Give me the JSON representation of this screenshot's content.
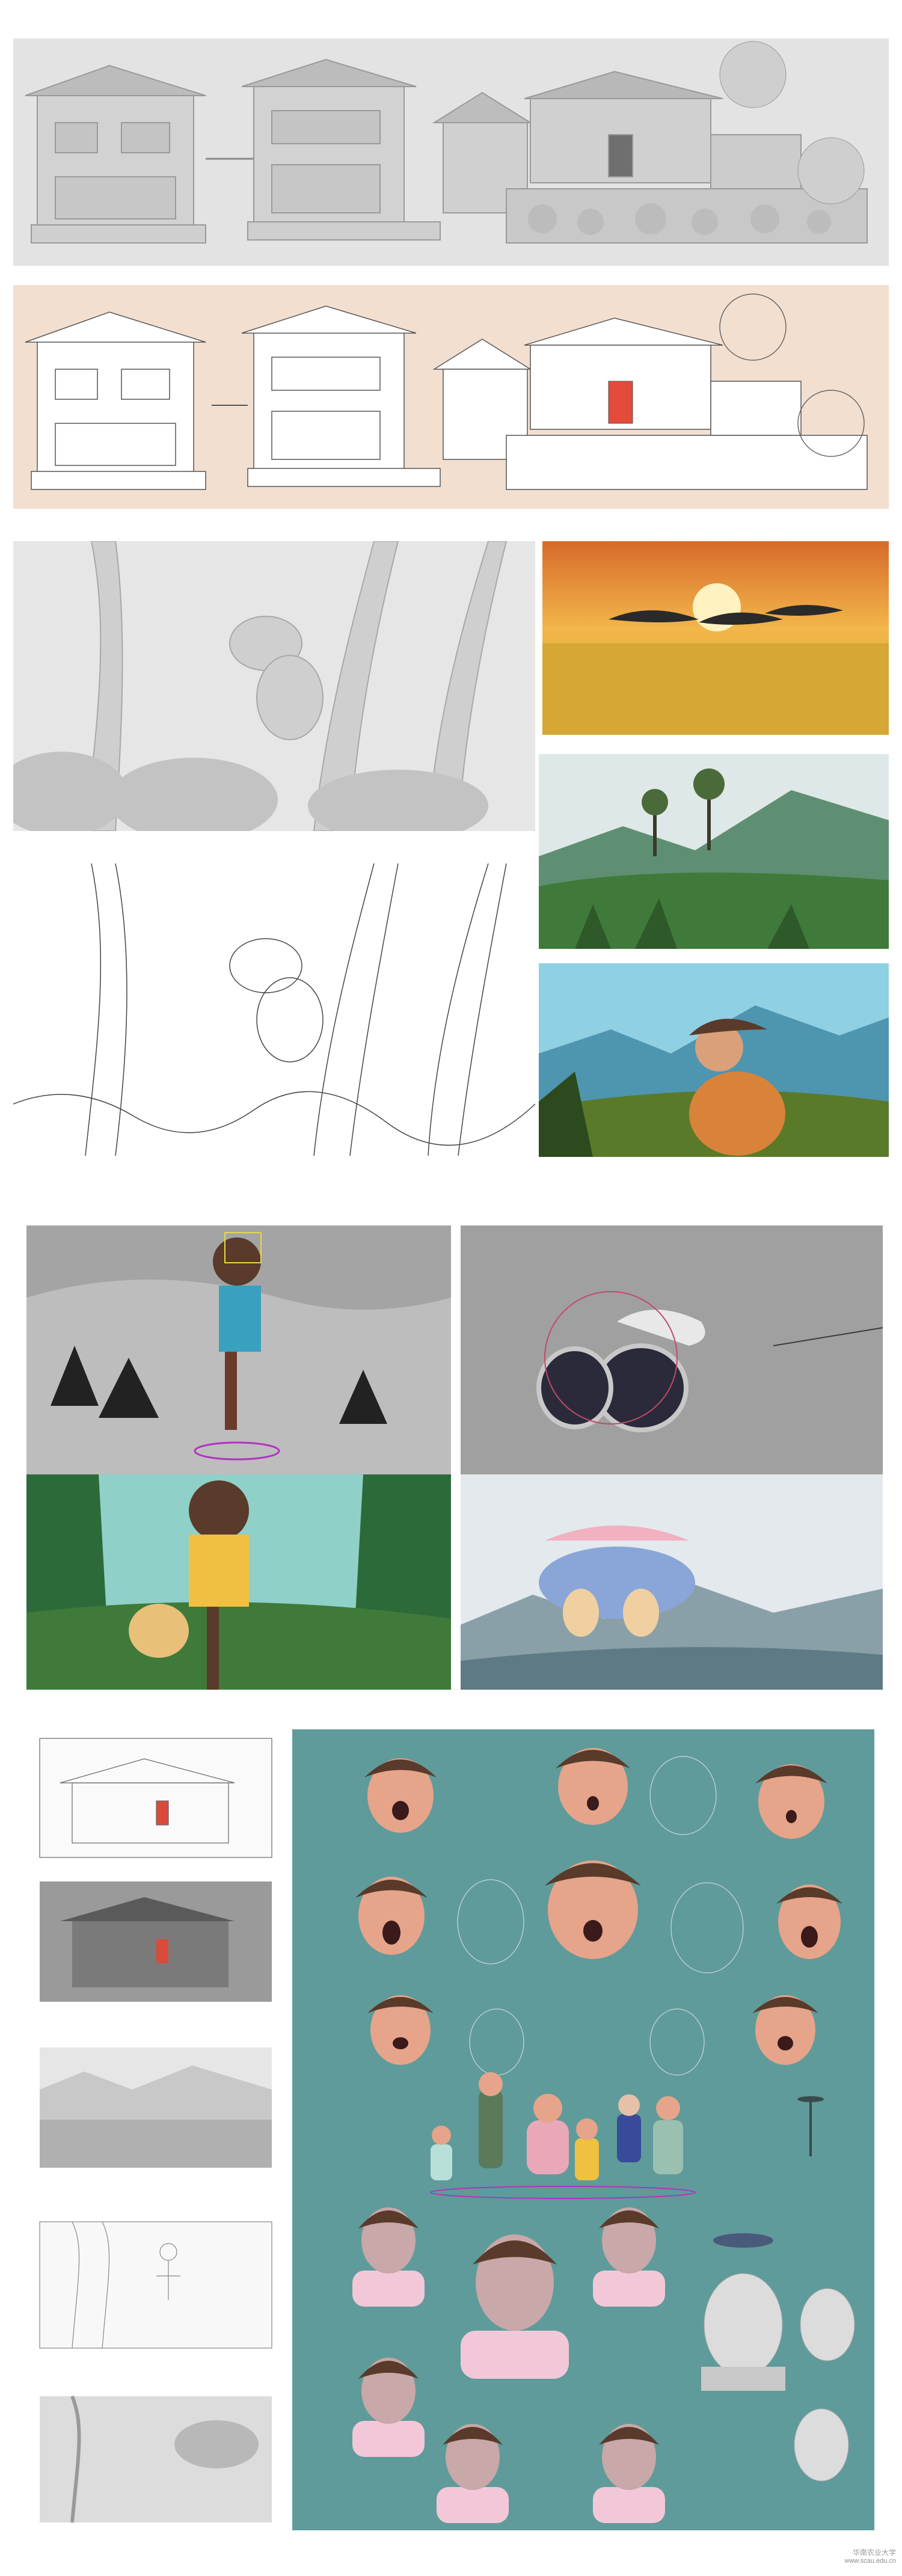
{
  "colors": {
    "page_bg": "#ffffff",
    "clay_gray": "#dcdcdc",
    "peach_bg": "#f2dfd0",
    "rig_teal": "#5f9b9a",
    "sunset_orange": "#e8a33a",
    "forest_green": "#3f7a3a",
    "sky_blue": "#7ec4d8"
  },
  "watermark": {
    "line1": "华南农业大学",
    "line2": "www.scau.edu.cn"
  },
  "panels": [
    {
      "name": "clay-houses-render",
      "icon": "house-clay-icon"
    },
    {
      "name": "lineart-houses-peach",
      "icon": "house-lineart-icon"
    },
    {
      "name": "clay-forest-character",
      "icon": "forest-clay-icon"
    },
    {
      "name": "sunset-birds-painting",
      "icon": "birds-sunset-icon"
    },
    {
      "name": "green-hills-painting",
      "icon": "hills-trees-icon"
    },
    {
      "name": "mountain-character-painting",
      "icon": "character-mountain-icon"
    },
    {
      "name": "lineart-forest",
      "icon": "forest-lineart-icon"
    },
    {
      "name": "rig-forest-character",
      "icon": "rig-character-icon"
    },
    {
      "name": "rig-falling-character",
      "icon": "rig-falling-icon"
    },
    {
      "name": "color-forest-character",
      "icon": "character-forest-icon"
    },
    {
      "name": "color-falling-clouds",
      "icon": "character-clouds-icon"
    },
    {
      "name": "storyboard-sketches",
      "icon": "storyboard-icon"
    },
    {
      "name": "character-rig-sheet",
      "icon": "character-sheet-icon"
    }
  ]
}
